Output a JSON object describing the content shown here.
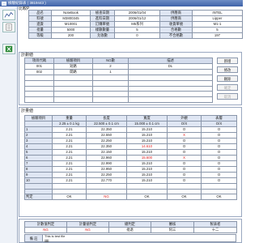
{
  "window": {
    "title": "檢驗紀錄表 ( 3819443 )"
  },
  "toolbar": {
    "buttons": [
      "chart",
      "doc",
      "excel"
    ]
  },
  "header_section_label": "比較P",
  "header": {
    "rows": [
      [
        "品名",
        "NoteBook",
        "檢查日期",
        "2006/01/04",
        "供應商",
        "INTEL"
      ],
      [
        "料號",
        "M3800345",
        "進料日期",
        "2006/01/12",
        "供應商",
        "Lipper"
      ],
      [
        "進貨",
        "M10001",
        "訂購單號",
        "M5系列",
        "收貨單號",
        "M1-1"
      ],
      [
        "批量",
        "5000",
        "樣數數量",
        "5",
        "合格數",
        "5"
      ],
      [
        "等級",
        "200",
        "允收數",
        "0",
        "不合格數",
        "197"
      ]
    ]
  },
  "plan": {
    "title": "計劃値",
    "columns": [
      "項目代碼",
      "檢驗項目",
      "NG數",
      "描述"
    ],
    "rows": [
      [
        "001",
        "短路",
        "2",
        "DL"
      ],
      [
        "002",
        "開路",
        "1",
        ""
      ]
    ],
    "buttons": [
      {
        "label": "新增",
        "enabled": true
      },
      {
        "label": "修改",
        "enabled": true
      },
      {
        "label": "刪除",
        "enabled": true
      },
      {
        "label": "確定",
        "enabled": false
      },
      {
        "label": "取消",
        "enabled": false
      }
    ]
  },
  "measure": {
    "title": "計量値",
    "headers": [
      "檢驗項目",
      "重量",
      "長度",
      "寬度",
      "外觀",
      "表層"
    ],
    "specs": [
      "",
      "2.25 ± 0.1 kg",
      "22.500 ± 0.1 cm",
      "15.000 ± 0.1 cm",
      "O/X",
      "O/X"
    ],
    "rows": [
      [
        "1",
        "2.21",
        "22.350",
        "15.210",
        "O",
        "O"
      ],
      [
        "2",
        "2.21",
        "22.550",
        "15.210",
        "X",
        "O"
      ],
      [
        "3",
        "2.21",
        "22.250",
        "15.210",
        "O",
        "O"
      ],
      [
        "4",
        "2.21",
        "22.350",
        "14.610",
        "O",
        "O"
      ],
      [
        "5",
        "2.21",
        "22.150",
        "15.210",
        "O",
        "O"
      ],
      [
        "6",
        "2.21",
        "22.960",
        "15.600",
        "X",
        "O"
      ],
      [
        "7",
        "2.21",
        "22.990",
        "15.210",
        "O",
        "O"
      ],
      [
        "8",
        "2.21",
        "22.950",
        "15.210",
        "O",
        "O"
      ],
      [
        "9",
        "2.21",
        "22.250",
        "15.210",
        "O",
        "O"
      ],
      [
        "10",
        "2.21",
        "22.770",
        "15.210",
        "O",
        "O"
      ]
    ],
    "judge_label": "判定",
    "judge": [
      "OK",
      "NG",
      "OK",
      "OK",
      "OK"
    ]
  },
  "judgement": {
    "headers": [
      "計數值判定",
      "計量値判定",
      "總判定",
      "審核",
      "製表者"
    ],
    "values": [
      "NG",
      "NG",
      "批退",
      "阿三",
      "十二"
    ],
    "ng_color": "#e02020"
  },
  "note": {
    "label": "備 註",
    "line1": "This is test file",
    "line2": "jjjjjj"
  }
}
